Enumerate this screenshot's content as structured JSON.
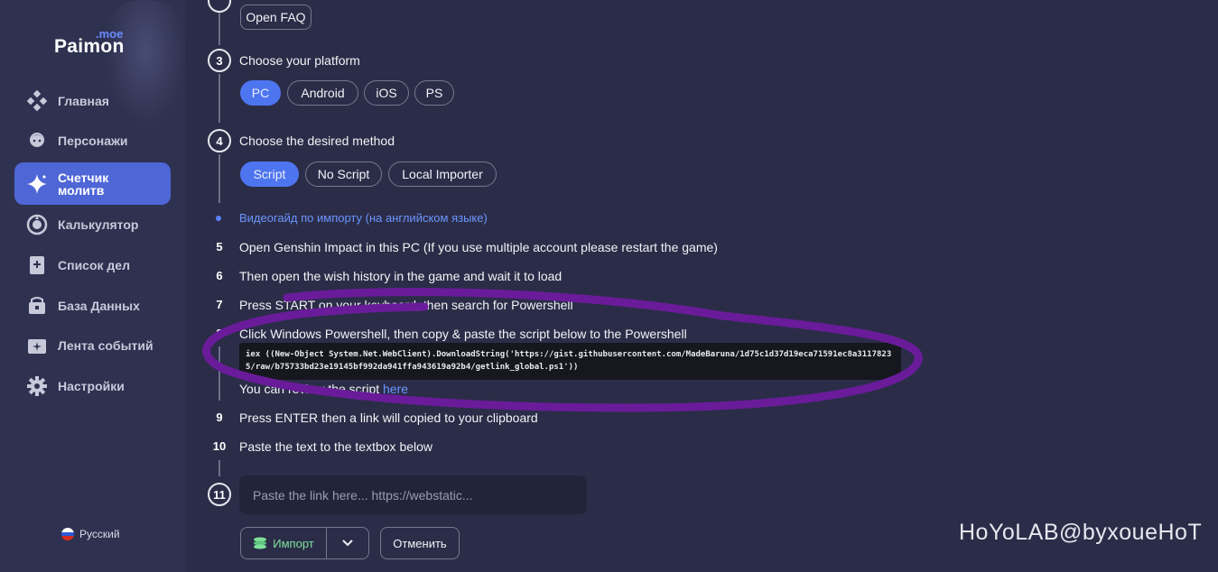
{
  "brand": {
    "tld": ".moe",
    "name": "Paimon"
  },
  "sidebar": {
    "items": [
      {
        "label": "Главная",
        "icon": "diamond-grid-icon"
      },
      {
        "label": "Персонажи",
        "icon": "character-face-icon"
      },
      {
        "label": "Счетчик молитв",
        "icon": "sparkle-icon",
        "active": true
      },
      {
        "label": "Калькулятор",
        "icon": "calculator-ring-icon"
      },
      {
        "label": "Список дел",
        "icon": "todo-list-icon"
      },
      {
        "label": "База Данных",
        "icon": "chest-icon"
      },
      {
        "label": "Лента событий",
        "icon": "event-feed-icon"
      },
      {
        "label": "Настройки",
        "icon": "gear-icon"
      }
    ],
    "language": "Русский"
  },
  "steps": {
    "faq_button": "Open FAQ",
    "s3": {
      "number": "3",
      "text": "Choose your platform",
      "options": [
        "PC",
        "Android",
        "iOS",
        "PS"
      ],
      "selected": "PC"
    },
    "s4": {
      "number": "4",
      "text": "Choose the desired method",
      "options": [
        "Script",
        "No Script",
        "Local Importer"
      ],
      "selected": "Script"
    },
    "video_guide": "Видеогайд по импорту (на английском языке)",
    "s5": {
      "number": "5",
      "text": "Open Genshin Impact in this PC (If you use multiple account please restart the game)"
    },
    "s6": {
      "number": "6",
      "text": "Then open the wish history in the game and wait it to load"
    },
    "s7": {
      "number": "7",
      "text": "Press START on your keyboard, then search for Powershell"
    },
    "s8": {
      "number": "8",
      "text": "Click Windows Powershell, then copy & paste the script below to the Powershell"
    },
    "script": "iex ((New-Object System.Net.WebClient).DownloadString('https://gist.githubusercontent.com/MadeBaruna/1d75c1d37d19eca71591ec8a31178235/raw/b75733bd23e19145bf992da941ffa943619a92b4/getlink_global.ps1'))",
    "review_prefix": "You can review the script ",
    "review_link": "here",
    "s9": {
      "number": "9",
      "text": "Press ENTER then a link will copied to your clipboard"
    },
    "s10": {
      "number": "10",
      "text": "Paste the text to the textbox below"
    },
    "s11": {
      "number": "11",
      "placeholder": "Paste the link here... https://webstatic..."
    }
  },
  "actions": {
    "import": "Импорт",
    "cancel": "Отменить"
  },
  "watermark": "HoYoLAB@byxoueHoT",
  "colors": {
    "accent": "#4e75f0",
    "annotation": "#6a1b9a"
  }
}
